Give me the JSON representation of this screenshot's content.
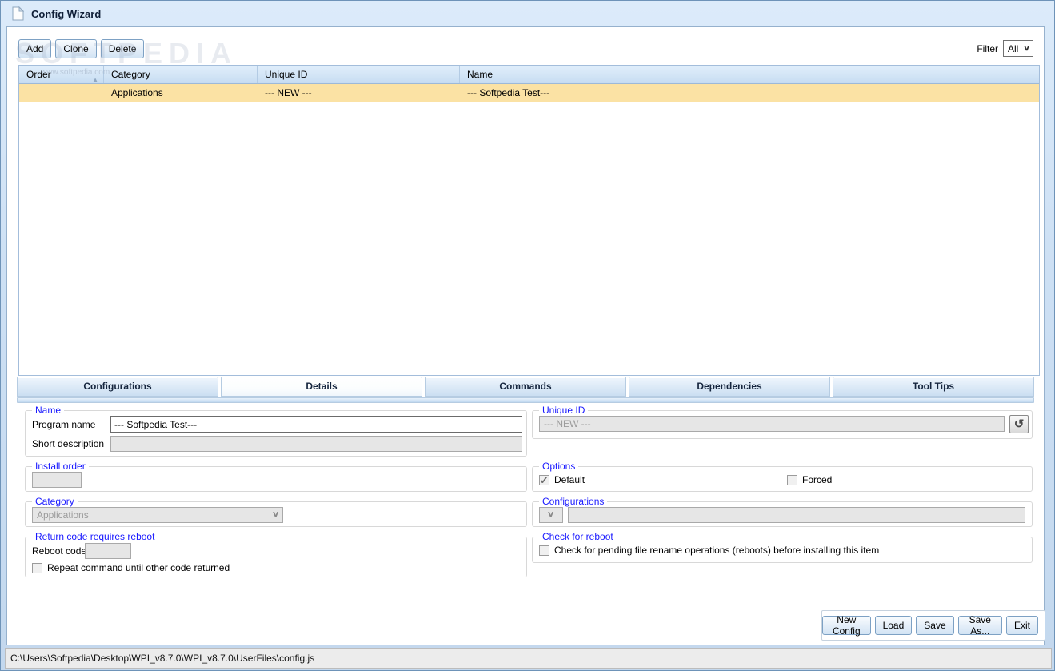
{
  "window": {
    "title": "Config Wizard"
  },
  "toolbar": {
    "buttons": [
      {
        "label": "Add"
      },
      {
        "label": "Clone"
      },
      {
        "label": "Delete"
      }
    ],
    "filter_label": "Filter",
    "filter_value": "All"
  },
  "grid": {
    "columns": [
      "Order",
      "Category",
      "Unique ID",
      "Name"
    ],
    "rows": [
      {
        "order": "",
        "category": "Applications",
        "unique_id": "--- NEW ---",
        "name": "--- Softpedia Test---",
        "selected": true
      }
    ]
  },
  "tabs": [
    {
      "label": "Configurations",
      "active": false
    },
    {
      "label": "Details",
      "active": true
    },
    {
      "label": "Commands",
      "active": false
    },
    {
      "label": "Dependencies",
      "active": false
    },
    {
      "label": "Tool Tips",
      "active": false
    }
  ],
  "details": {
    "name_group": {
      "legend": "Name",
      "program_name_label": "Program name",
      "program_name_value": "--- Softpedia Test---",
      "short_description_label": "Short description",
      "short_description_value": ""
    },
    "unique_id_group": {
      "legend": "Unique ID",
      "value": "--- NEW ---"
    },
    "install_order_group": {
      "legend": "Install order",
      "value": ""
    },
    "options_group": {
      "legend": "Options",
      "default_label": "Default",
      "default_checked": true,
      "forced_label": "Forced",
      "forced_checked": false
    },
    "category_group": {
      "legend": "Category",
      "value": "Applications"
    },
    "configurations_group": {
      "legend": "Configurations",
      "value": ""
    },
    "return_code_group": {
      "legend": "Return code requires reboot",
      "reboot_code_label": "Reboot code",
      "reboot_code_value": "",
      "repeat_checkbox_label": "Repeat command until other code returned",
      "repeat_checked": false
    },
    "check_reboot_group": {
      "legend": "Check for reboot",
      "checkbox_label": "Check for pending file rename operations (reboots) before installing this item",
      "checked": false
    }
  },
  "footer": {
    "buttons": [
      {
        "label": "New Config"
      },
      {
        "label": "Load"
      },
      {
        "label": "Save"
      },
      {
        "label": "Save As..."
      },
      {
        "label": "Exit"
      }
    ]
  },
  "status_bar": {
    "path": "C:\\Users\\Softpedia\\Desktop\\WPI_v8.7.0\\WPI_v8.7.0\\UserFiles\\config.js"
  },
  "watermarks": {
    "large": "SOFTPEDIA",
    "small": "www.softpedia.com"
  },
  "icons": {
    "check": "✓",
    "chevron": "∨",
    "refresh": "↺",
    "sort_asc": "▲"
  },
  "colors": {
    "selected_row": "#fbe2a4",
    "legend_blue": "#1818ff",
    "frame_blue": "#cde0f4"
  }
}
